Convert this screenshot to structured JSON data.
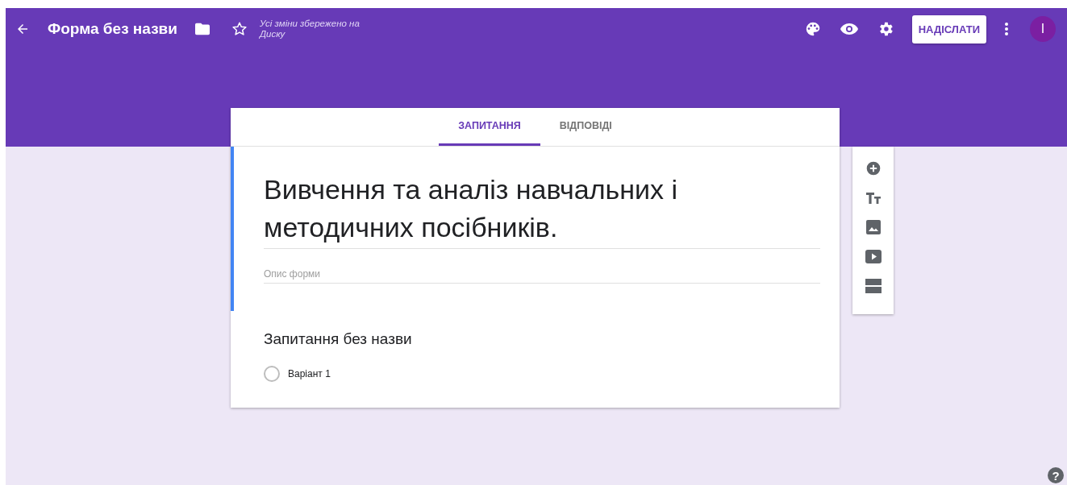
{
  "header": {
    "title": "Форма без назви",
    "save_status": "Усі зміни збережено на Диску",
    "send_button": "НАДІСЛАТИ",
    "avatar": "I"
  },
  "tabs": [
    {
      "label": "ЗАПИТАННЯ",
      "selected": true
    },
    {
      "label": "ВІДПОВІДІ",
      "selected": false
    }
  ],
  "form": {
    "title": "Вивчення та аналіз навчальних і методичних посібників.",
    "description": {
      "placeholder": "Опис форми"
    }
  },
  "question": {
    "title": "Запитання без назви",
    "options": [
      {
        "label": "Варіант 1",
        "selected": false
      }
    ]
  },
  "toolbar": [
    {
      "kind": "add"
    },
    {
      "kind": "text"
    },
    {
      "kind": "image"
    },
    {
      "kind": "video"
    },
    {
      "kind": "section"
    }
  ],
  "help": "?"
}
